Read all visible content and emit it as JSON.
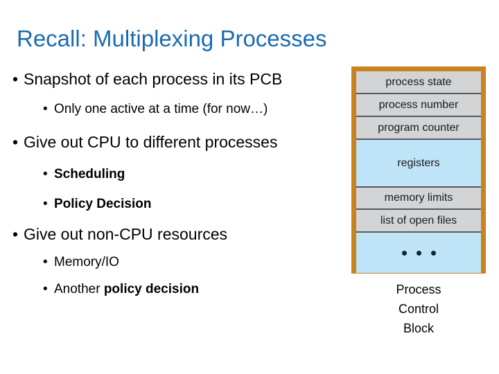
{
  "slide": {
    "title": "Recall: Multiplexing Processes",
    "title_color": "#1a6bb0",
    "background_color": "#ffffff"
  },
  "bullets": [
    {
      "level": 1,
      "text": "Snapshot of each process in its PCB",
      "bold": false
    },
    {
      "level": 2,
      "text": "Only one active at a time (for now…)",
      "bold": false
    },
    {
      "level": 1,
      "text": "Give out CPU to different processes",
      "bold": false
    },
    {
      "level": 2,
      "text": "Scheduling",
      "bold": true
    },
    {
      "level": 2,
      "text": "Policy Decision",
      "bold": true
    },
    {
      "level": 1,
      "text": "Give out non-CPU resources",
      "bold": false
    },
    {
      "level": 2,
      "text": "Memory/IO",
      "bold": false
    }
  ],
  "last_bullet": {
    "level": 2,
    "prefix": "Another ",
    "bold_text": "policy decision"
  },
  "bullet_marker": "•",
  "pcb": {
    "border_color": "#c8821f",
    "gray_color": "#d2d4d6",
    "blue_color": "#bfe4f8",
    "divider_color": "#55595c",
    "rows": [
      {
        "label": "process state",
        "fill": "gray"
      },
      {
        "label": "process number",
        "fill": "gray"
      },
      {
        "label": "program counter",
        "fill": "gray"
      },
      {
        "label": "registers",
        "fill": "blue"
      },
      {
        "label": "memory limits",
        "fill": "gray"
      },
      {
        "label": "list of open files",
        "fill": "gray"
      },
      {
        "label": "",
        "fill": "blue",
        "glyph": "three-dots"
      }
    ],
    "caption_line1": "Process",
    "caption_line2": "Control",
    "caption_line3": "Block"
  }
}
